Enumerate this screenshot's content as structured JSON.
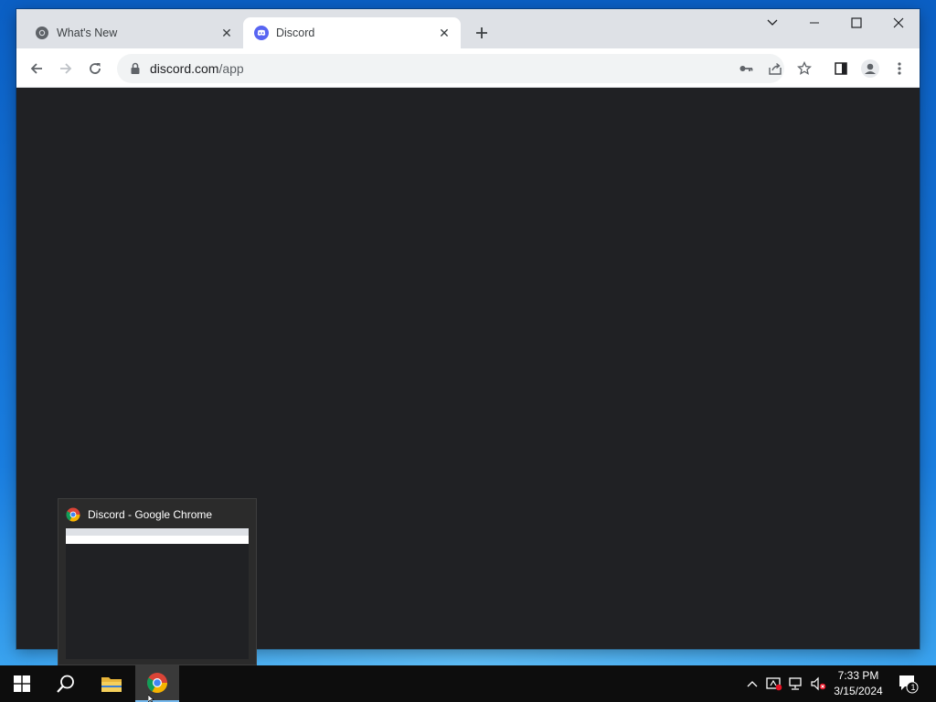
{
  "browser": {
    "tabs": [
      {
        "title": "What's New",
        "active": false,
        "favicon": "chrome-icon"
      },
      {
        "title": "Discord",
        "active": true,
        "favicon": "discord-icon"
      }
    ],
    "omnibox": {
      "host": "discord.com",
      "path": "/app"
    },
    "colors": {
      "discord_brand": "#5865f2",
      "content_background": "#202124",
      "tabstrip": "#dee1e6"
    }
  },
  "preview": {
    "title": "Discord - Google Chrome"
  },
  "taskbar": {
    "clock_time": "7:33 PM",
    "clock_date": "3/15/2024",
    "notification_count": "1"
  }
}
